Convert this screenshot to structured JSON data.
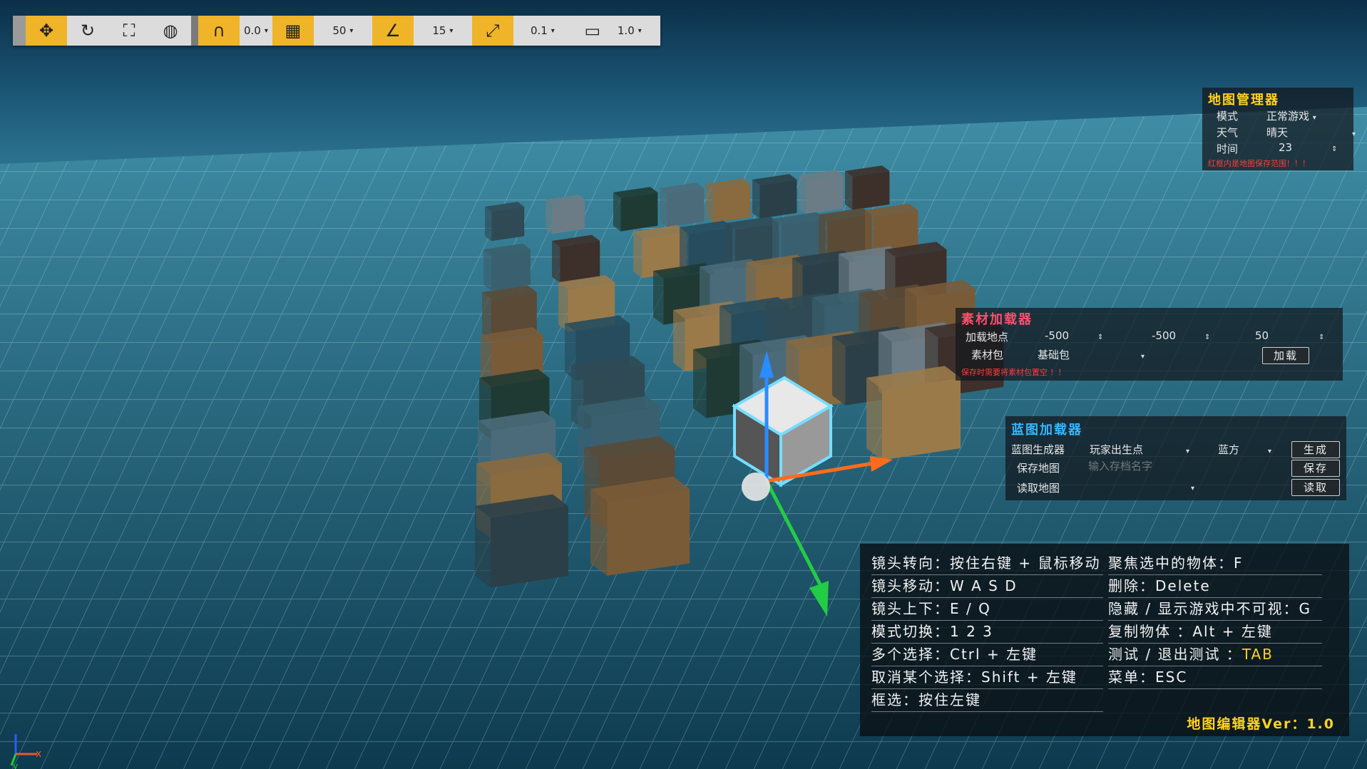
{
  "toolbar": {
    "grip": "grip",
    "move_icon": "move-arrows-icon",
    "rotate_icon": "rotate-icon",
    "scale_icon": "scale-expand-icon",
    "global_icon": "globe-icon",
    "magnet_icon": "magnet-snap-icon",
    "magnet_value": "0.0",
    "grid_icon": "grid-icon",
    "grid_value": "50",
    "angle_icon": "angle-snap-icon",
    "angle_value": "15",
    "scale_snap_icon": "scale-snap-arrow-icon",
    "scale_value": "0.1",
    "camera_icon": "camera-icon",
    "camera_value": "1.0"
  },
  "map_manager": {
    "title": "地图管理器",
    "mode_label": "模式",
    "mode_value": "正常游戏",
    "weather_label": "天气",
    "weather_value": "晴天",
    "time_label": "时间",
    "time_value": "23",
    "warning": "红框内是地图保存范围！！！"
  },
  "asset_loader": {
    "title": "素材加载器",
    "location_label": "加载地点",
    "x_value": "-500",
    "y_value": "-500",
    "z_value": "50",
    "load_button": "加载",
    "pack_label": "素材包",
    "pack_value": "基础包",
    "warning": "保存时需要将素材包置空 ！！"
  },
  "blueprint_loader": {
    "title": "蓝图加载器",
    "generator_label": "蓝图生成器",
    "generator_value": "玩家出生点",
    "team_value": "蓝方",
    "generate_button": "生成",
    "save_label": "保存地图",
    "save_placeholder": "输入存档名字",
    "save_button": "保存",
    "read_label": "读取地图",
    "read_button": "读取"
  },
  "help": {
    "left": [
      "镜头转向：按住右键 + 鼠标移动",
      "镜头移动：W A S D",
      "镜头上下：E / Q",
      "模式切换：1 2 3",
      "多个选择：Ctrl + 左键",
      "取消某个选择：Shift + 左键",
      "框选：按住左键"
    ],
    "right": [
      "聚焦选中的物体：F",
      "删除：Delete",
      "隐藏 / 显示游戏中不可视：G",
      "复制物体 ：Alt + 左键",
      "测试 / 退出测试 ：",
      "菜单：ESC"
    ],
    "test_key": "TAB",
    "version": "地图编辑器Ver：1.0"
  },
  "axis": {
    "x": "x",
    "y": "y"
  },
  "colors": {
    "accent": "#f0b429",
    "title_yellow": "#ffd21f",
    "title_red": "#ff4d6d",
    "title_blue": "#35b7ff",
    "warning_red": "#ff3b3b"
  }
}
